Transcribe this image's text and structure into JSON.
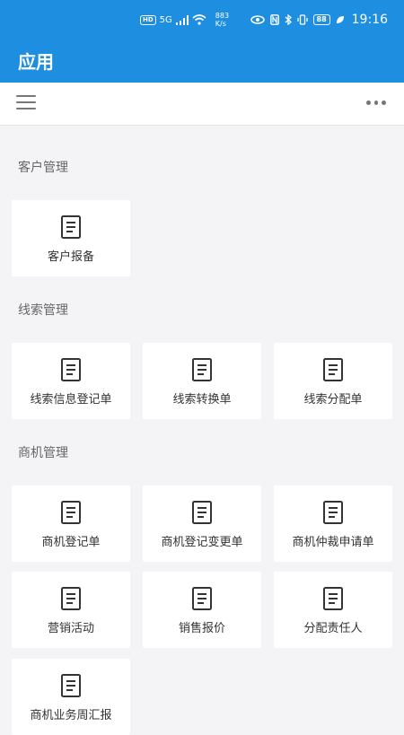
{
  "status_bar": {
    "hd": "HD",
    "network": "5G",
    "speed_value": "883",
    "speed_unit": "K/s",
    "battery": "88",
    "time": "19:16"
  },
  "header": {
    "title": "应用"
  },
  "toolbar": {
    "menu_icon": "hamburger-menu-icon",
    "more_icon": "more-dots-icon"
  },
  "sections": [
    {
      "title": "客户管理",
      "items": [
        "客户报备"
      ]
    },
    {
      "title": "线索管理",
      "items": [
        "线索信息登记单",
        "线索转换单",
        "线索分配单"
      ]
    },
    {
      "title": "商机管理",
      "items": [
        "商机登记单",
        "商机登记变更单",
        "商机仲裁申请单",
        "营销活动",
        "销售报价",
        "分配责任人",
        "商机业务周汇报"
      ]
    }
  ],
  "colors": {
    "primary": "#1e8ee0",
    "background": "#f4f4f6",
    "card": "#ffffff"
  }
}
